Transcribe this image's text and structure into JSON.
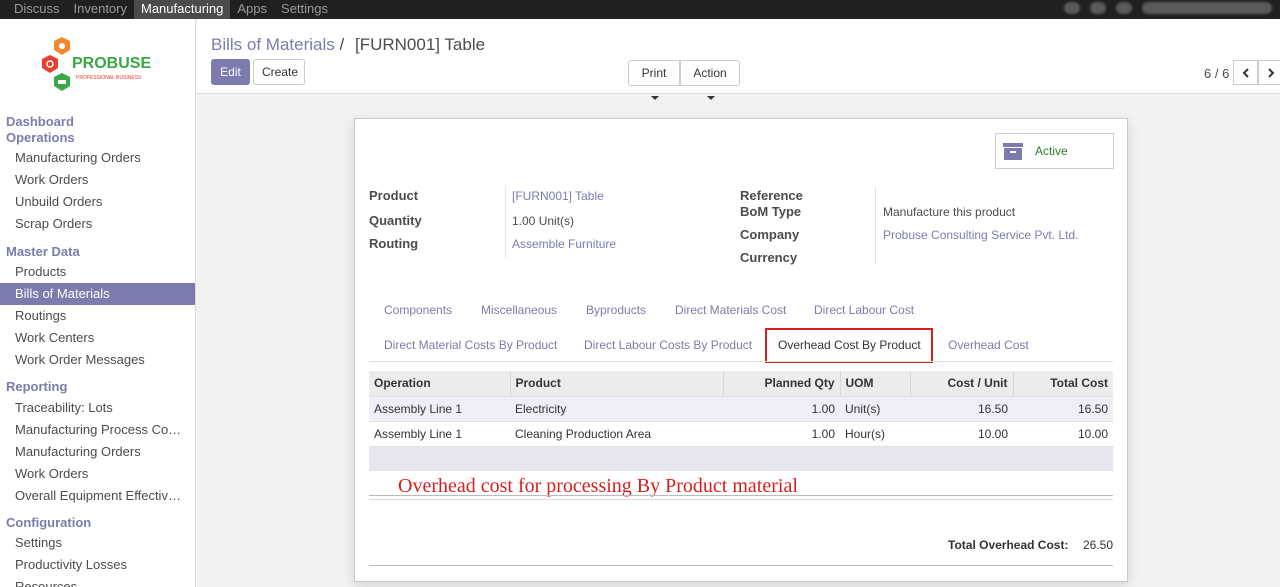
{
  "topbar": {
    "menu": [
      "Discuss",
      "Inventory",
      "Manufacturing",
      "Apps",
      "Settings"
    ],
    "active": "Manufacturing"
  },
  "brand": {
    "name": "PROBUSE",
    "tagline": "PROFESSIONAL BUSINESS",
    "colors": {
      "orange": "#f08a2c",
      "red": "#e4402f",
      "green": "#3aa845",
      "blue": "#2a7ac0"
    }
  },
  "sidebar": {
    "sections": [
      {
        "title": "Dashboard",
        "items": []
      },
      {
        "title": "Operations",
        "items": [
          "Manufacturing Orders",
          "Work Orders",
          "Unbuild Orders",
          "Scrap Orders"
        ]
      },
      {
        "title": "Master Data",
        "items": [
          "Products",
          "Bills of Materials",
          "Routings",
          "Work Centers",
          "Work Order Messages"
        ]
      },
      {
        "title": "Reporting",
        "items": [
          "Traceability: Lots",
          "Manufacturing Process Co…",
          "Manufacturing Orders",
          "Work Orders",
          "Overall Equipment Effectiv…"
        ]
      },
      {
        "title": "Configuration",
        "items": [
          "Settings",
          "Productivity Losses",
          "Resources"
        ]
      }
    ],
    "active_item": "Bills of Materials"
  },
  "breadcrumb": {
    "parent": "Bills of Materials",
    "sep": "/",
    "current": "[FURN001] Table"
  },
  "actions": {
    "edit": "Edit",
    "create": "Create",
    "print": "Print",
    "action": "Action"
  },
  "pager": {
    "value": "6 / 6"
  },
  "status_button": {
    "label": "Active"
  },
  "form": {
    "left": [
      {
        "label": "Product",
        "value": "[FURN001] Table",
        "link": true
      },
      {
        "label": "Quantity",
        "value": "1.00 Unit(s)",
        "link": false
      },
      {
        "label": "Routing",
        "value": "Assemble Furniture",
        "link": true
      }
    ],
    "right": [
      {
        "label": "Reference",
        "value": "",
        "link": false
      },
      {
        "label": "BoM Type",
        "value": "Manufacture this product",
        "link": false
      },
      {
        "label": "Company",
        "value": "Probuse Consulting Service Pvt. Ltd.",
        "link": true
      },
      {
        "label": "Currency",
        "value": "",
        "link": false
      }
    ]
  },
  "tabs": {
    "row1": [
      "Components",
      "Miscellaneous",
      "Byproducts",
      "Direct Materials Cost",
      "Direct Labour Cost"
    ],
    "row2": [
      "Direct Material Costs By Product",
      "Direct Labour Costs By Product",
      "Overhead Cost By Product",
      "Overhead Cost"
    ],
    "active": "Overhead Cost By Product"
  },
  "table": {
    "columns": [
      "Operation",
      "Product",
      "Planned Qty",
      "UOM",
      "Cost / Unit",
      "Total Cost"
    ],
    "rows": [
      [
        "Assembly Line 1",
        "Electricity",
        "1.00",
        "Unit(s)",
        "16.50",
        "16.50"
      ],
      [
        "Assembly Line 1",
        "Cleaning Production Area",
        "1.00",
        "Hour(s)",
        "10.00",
        "10.00"
      ]
    ]
  },
  "annotation": "Overhead cost for processing By Product material",
  "totals": {
    "label": "Total Overhead Cost:",
    "value": "26.50"
  }
}
